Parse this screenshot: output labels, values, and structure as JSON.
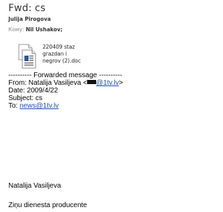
{
  "message": {
    "subject": "Fwd: cs",
    "sender": "Julija Pirogova",
    "to_label": "Кому:",
    "to_name": "Nil Ushakov;"
  },
  "attachment": {
    "icon": "document-icon",
    "name_line1": "220409 staz",
    "name_line2": "grazdan i",
    "name_line3": "negrov (2).doc"
  },
  "forwarded": {
    "separator": "---------- Forwarded message ----------",
    "from_label": "From: Natalija Vasiljeva <",
    "from_email_visible": "@1tv.lv",
    "from_close": ">",
    "date": "Date: 2009/4/22",
    "subject": "Subject: cs",
    "to_label": "To: ",
    "to_email": "news@1tv.lv"
  },
  "signature": {
    "name": "Natalija Vasiljeva",
    "role": "Ziņu dienesta producente"
  }
}
